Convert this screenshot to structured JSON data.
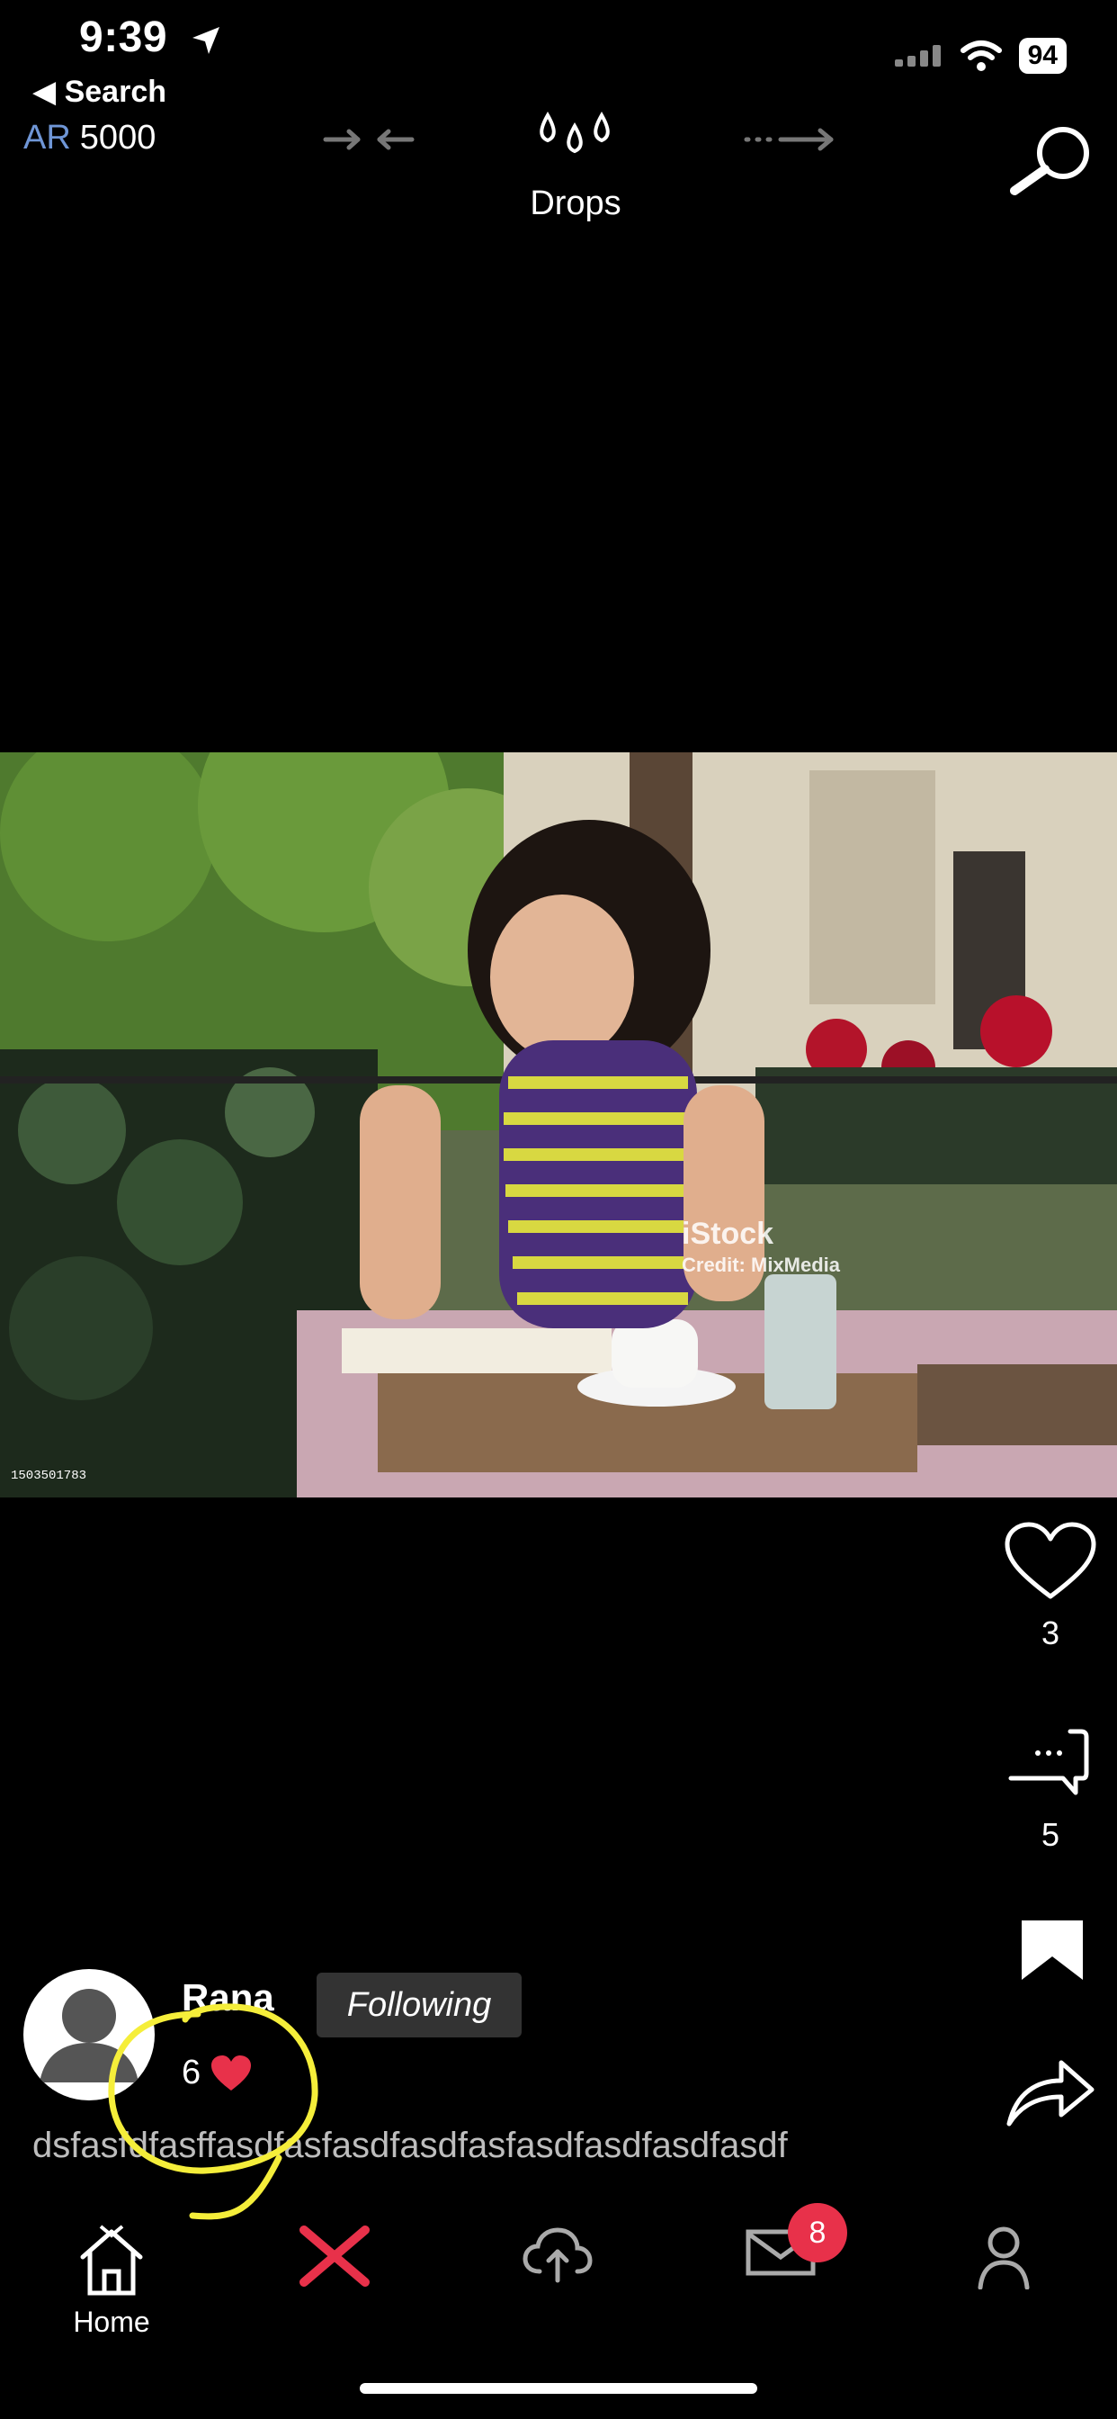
{
  "status_bar": {
    "time": "9:39",
    "back_label": "◀ Search",
    "battery": "94"
  },
  "header": {
    "currency": "AR",
    "balance": "5000",
    "title": "Drops"
  },
  "post": {
    "watermark_brand": "iStock",
    "watermark_credit": "Credit: MixMedia",
    "image_id": "1503501783",
    "likes": "3",
    "comments": "5",
    "author_name": "Rana",
    "follow_label": "Following",
    "drops_received": "6",
    "caption": "dsfasfdfasffasdfasfasdfasdfasfasdfasdfasdfasdf"
  },
  "tab_bar": {
    "home_label": "Home",
    "inbox_badge": "8"
  },
  "colors": {
    "accent_red": "#e8314a",
    "currency_blue": "#6f96d6",
    "annotation_yellow": "#f5ee3a"
  }
}
